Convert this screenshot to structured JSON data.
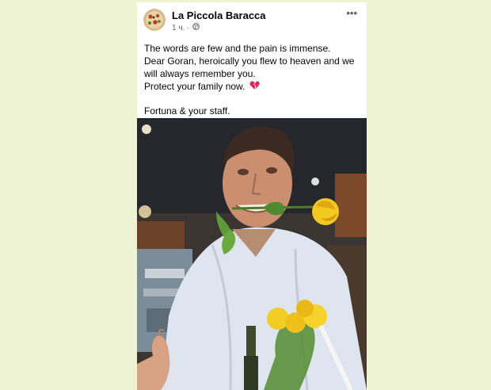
{
  "post": {
    "page_name": "La Piccola Baracca",
    "time": "1 ч.",
    "separator": "·",
    "privacy_icon": "globe-icon",
    "more_icon": "more-dots-icon",
    "more_label": "•••",
    "text_lines": [
      "The words are few and the pain is immense.",
      "Dear Goran, heroically you flew to heaven and we",
      "will always remember you.",
      "Protect your family now."
    ],
    "heart_icon": "broken-heart-icon",
    "signature": "Fortuna & your staff."
  },
  "colors": {
    "page_background": "#eef4d3",
    "card_background": "#ffffff",
    "text": "#050505",
    "meta_text": "#65676b",
    "heart": "#e0245e"
  }
}
